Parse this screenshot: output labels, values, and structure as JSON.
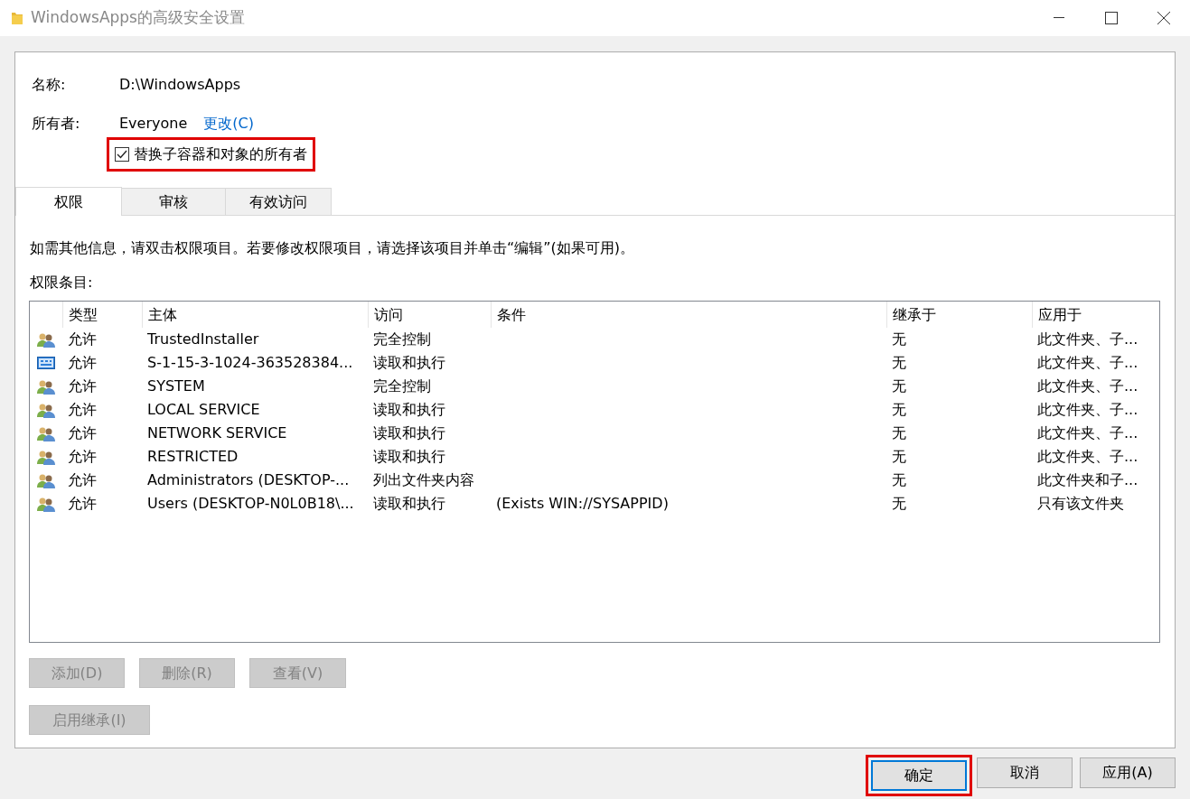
{
  "window": {
    "title": "WindowsApps的高级安全设置"
  },
  "name_label": "名称:",
  "name_value": "D:\\WindowsApps",
  "owner_label": "所有者:",
  "owner_value": "Everyone",
  "owner_change_link": "更改(C)",
  "replace_owner": {
    "label": "替换子容器和对象的所有者",
    "checked": true,
    "highlighted": true
  },
  "tabs": [
    {
      "label": "权限",
      "selected": true
    },
    {
      "label": "审核",
      "selected": false
    },
    {
      "label": "有效访问",
      "selected": false
    }
  ],
  "info_text": "如需其他信息，请双击权限项目。若要修改权限项目，请选择该项目并单击“编辑”(如果可用)。",
  "entries_label": "权限条目:",
  "table": {
    "columns": [
      "类型",
      "主体",
      "访问",
      "条件",
      "继承于",
      "应用于"
    ],
    "rows": [
      {
        "kind": "group",
        "cells": [
          "允许",
          "TrustedInstaller",
          "完全控制",
          "",
          "无",
          "此文件夹、子..."
        ]
      },
      {
        "kind": "app",
        "cells": [
          "允许",
          "S-1-15-3-1024-363528384...",
          "读取和执行",
          "",
          "无",
          "此文件夹、子..."
        ]
      },
      {
        "kind": "group",
        "cells": [
          "允许",
          "SYSTEM",
          "完全控制",
          "",
          "无",
          "此文件夹、子..."
        ]
      },
      {
        "kind": "group",
        "cells": [
          "允许",
          "LOCAL SERVICE",
          "读取和执行",
          "",
          "无",
          "此文件夹、子..."
        ]
      },
      {
        "kind": "group",
        "cells": [
          "允许",
          "NETWORK SERVICE",
          "读取和执行",
          "",
          "无",
          "此文件夹、子..."
        ]
      },
      {
        "kind": "group",
        "cells": [
          "允许",
          "RESTRICTED",
          "读取和执行",
          "",
          "无",
          "此文件夹、子..."
        ]
      },
      {
        "kind": "group",
        "cells": [
          "允许",
          "Administrators (DESKTOP-...",
          "列出文件夹内容",
          "",
          "无",
          "此文件夹和子..."
        ]
      },
      {
        "kind": "group",
        "cells": [
          "允许",
          "Users (DESKTOP-N0L0B18\\...",
          "读取和执行",
          "(Exists WIN://SYSAPPID)",
          "无",
          "只有该文件夹"
        ]
      }
    ]
  },
  "action_buttons": [
    {
      "label": "添加(D)",
      "disabled": true
    },
    {
      "label": "删除(R)",
      "disabled": true
    },
    {
      "label": "查看(V)",
      "disabled": true
    }
  ],
  "inherit_button": {
    "label": "启用继承(I)",
    "disabled": true
  },
  "dialog_buttons": [
    {
      "label": "确定",
      "default": true,
      "highlighted": true
    },
    {
      "label": "取消",
      "default": false,
      "highlighted": false
    },
    {
      "label": "应用(A)",
      "default": false,
      "highlighted": false
    }
  ]
}
